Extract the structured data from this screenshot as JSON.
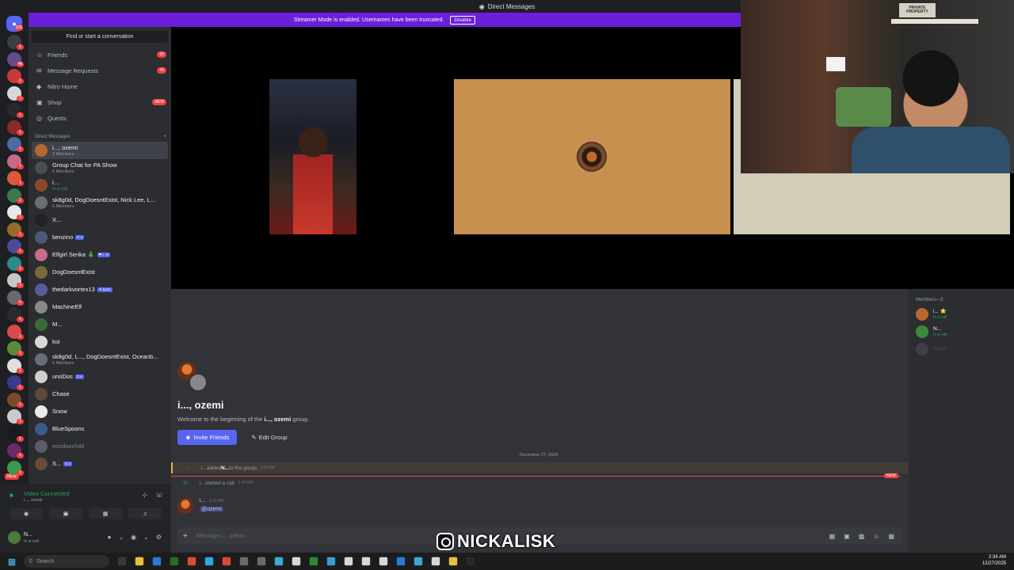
{
  "window": {
    "title": "Direct Messages"
  },
  "banner": {
    "text": "Streamer Mode is enabled. Usernames have been truncated.",
    "button": "Disable"
  },
  "rail": {
    "home_badge": "109",
    "server_badges": [
      "1",
      "48",
      "1",
      "1",
      "1",
      "1",
      "1",
      "1",
      "1",
      "2",
      "1",
      "1",
      "1",
      "1",
      "1",
      "6",
      "1",
      "1",
      "1",
      "1",
      "1",
      "1",
      "1",
      "1",
      "1",
      "1",
      "20"
    ],
    "new_label": "NEW"
  },
  "sidebar": {
    "search_placeholder": "Find or start a conversation",
    "nav": [
      {
        "label": "Friends",
        "icon": "friends-icon",
        "badge": "60"
      },
      {
        "label": "Message Requests",
        "icon": "message-requests-icon",
        "badge": "49"
      },
      {
        "label": "Nitro Home",
        "icon": "nitro-icon",
        "badge": ""
      },
      {
        "label": "Shop",
        "icon": "shop-icon",
        "badge": "NEW"
      },
      {
        "label": "Quests",
        "icon": "quests-icon",
        "badge": ""
      }
    ],
    "dm_header": "Direct Messages",
    "dm_add": "+",
    "dms": [
      {
        "name": "i..., ozemi",
        "sub": "3 Members",
        "subtype": "plain",
        "tag": "",
        "dim": false,
        "color": "#b8672e"
      },
      {
        "name": "Group Chat for PA Show",
        "sub": "6 Members",
        "subtype": "plain",
        "tag": "",
        "dim": false,
        "color": "#4a4d56"
      },
      {
        "name": "i...",
        "sub": "In a call",
        "subtype": "call",
        "tag": "",
        "dim": false,
        "color": "#8a4a2a"
      },
      {
        "name": "sk8g0d, DogDoesntExist, Nick Lee, L...",
        "sub": "5 Members",
        "subtype": "plain",
        "tag": "",
        "dim": false,
        "color": "#6a6d76"
      },
      {
        "name": "X...",
        "sub": "",
        "subtype": "plain",
        "tag": "",
        "dim": false,
        "color": "#222222"
      },
      {
        "name": "benzino",
        "sub": "",
        "subtype": "plain",
        "tag": "C x",
        "dim": false,
        "color": "#4a5a7a"
      },
      {
        "name": "Elfgirl Serika 🎄",
        "sub": "",
        "subtype": "plain",
        "tag": "❤✓ ☠",
        "dim": false,
        "color": "#c86a8a"
      },
      {
        "name": "DogDoesntExist",
        "sub": "",
        "subtype": "plain",
        "tag": "",
        "dim": false,
        "color": "#7a6a3a"
      },
      {
        "name": "thedarkvortex13",
        "sub": "",
        "subtype": "plain",
        "tag": "✦ bunz",
        "dim": false,
        "color": "#5a5a9a"
      },
      {
        "name": "MachineElf",
        "sub": "",
        "subtype": "plain",
        "tag": "",
        "dim": false,
        "color": "#8a8a8a"
      },
      {
        "name": "M...",
        "sub": "",
        "subtype": "plain",
        "tag": "",
        "dim": false,
        "color": "#3a6a3a"
      },
      {
        "name": "koi",
        "sub": "",
        "subtype": "plain",
        "tag": "",
        "dim": false,
        "color": "#d8d8d8"
      },
      {
        "name": "sk8g0d, L..., DogDoesntExist, Oceanb...",
        "sub": "5 Members",
        "subtype": "plain",
        "tag": "",
        "dim": false,
        "color": "#6a6d76"
      },
      {
        "name": "unoDos",
        "sub": "",
        "subtype": "plain",
        "tag": "C x",
        "dim": false,
        "color": "#d0d0d0"
      },
      {
        "name": "Chase",
        "sub": "",
        "subtype": "plain",
        "tag": "",
        "dim": false,
        "color": "#5a4a3a"
      },
      {
        "name": "Snow",
        "sub": "",
        "subtype": "plain",
        "tag": "",
        "dim": false,
        "color": "#eaeaea"
      },
      {
        "name": "BlueSpoons",
        "sub": "",
        "subtype": "plain",
        "tag": "",
        "dim": false,
        "color": "#3a5a8a"
      },
      {
        "name": "voodoochild",
        "sub": "",
        "subtype": "plain",
        "tag": "",
        "dim": true,
        "color": "#5a5d66"
      },
      {
        "name": "S...",
        "sub": "",
        "subtype": "plain",
        "tag": "C x",
        "dim": false,
        "color": "#6a4a3a"
      }
    ]
  },
  "voice": {
    "status": "Video Connected",
    "channel": "i..., ozemi"
  },
  "user": {
    "name": "N...",
    "status": "In a call"
  },
  "call": {
    "label": ""
  },
  "webcam": {
    "sign": "PRIVATE PROPERTY"
  },
  "chat": {
    "group_title": "i..., ozemi",
    "welcome_pre": "Welcome to the beginning of the ",
    "welcome_name": "i..., ozemi",
    "welcome_post": " group.",
    "invite_label": "Invite Friends",
    "edit_label": "Edit Group",
    "date_divider": "December 27, 2025",
    "new_label": "NEW",
    "sys1": {
      "actor": "i...",
      "mid1": " added ",
      "target": "N...",
      "mid2": " to the group.",
      "time": "2:09 AM"
    },
    "sys2": {
      "actor": "i...",
      "mid": " started a call.",
      "time": "2:10 AM"
    },
    "msg": {
      "author": "i...",
      "time": "2:12 AM",
      "mention": "@ozemi"
    },
    "composer_placeholder": "Message i..., ozemi"
  },
  "members": {
    "header": "Members—3",
    "list": [
      {
        "name": "i... ⭐",
        "status": "In a call",
        "color": "#b8672e",
        "off": false
      },
      {
        "name": "N...",
        "status": "In a call",
        "color": "#3a8a3a",
        "off": false
      },
      {
        "name": "ozemi",
        "status": "",
        "color": "#5a5d66",
        "off": true
      }
    ]
  },
  "watermark": {
    "handle": "NICKALISK"
  },
  "taskbar": {
    "search_placeholder": "Search",
    "time": "2:34 AM",
    "date": "12/27/2025"
  }
}
